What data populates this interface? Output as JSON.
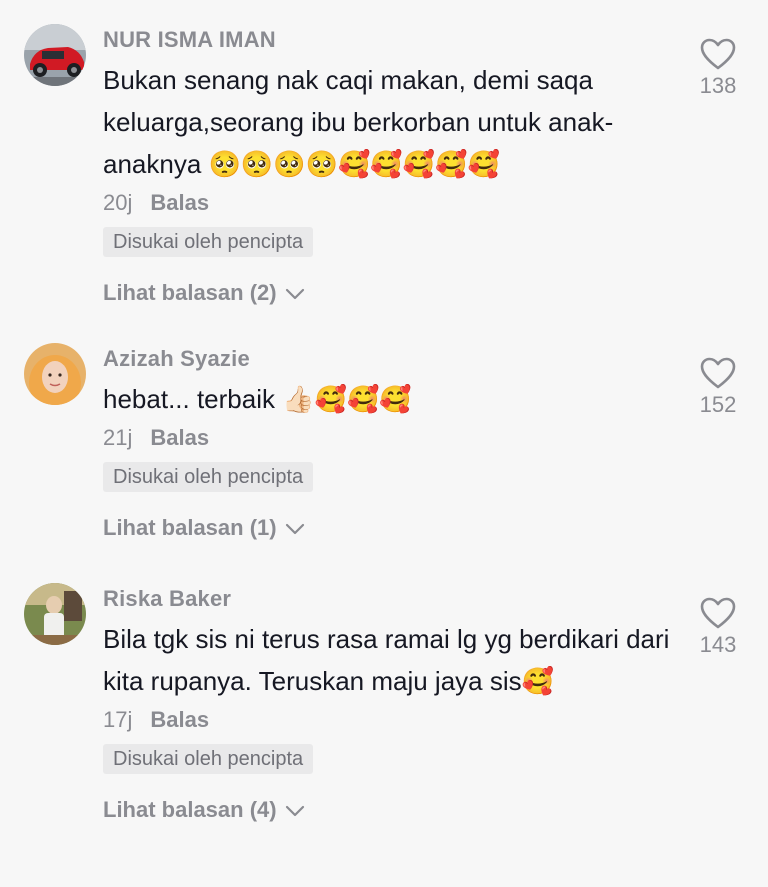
{
  "comments": [
    {
      "username": "NUR ISMA IMAN",
      "text": "Bukan senang nak caqi makan, demi saqa keluarga,seorang ibu berkorban untuk anak-anaknya 🥺🥺🥺🥺🥰🥰🥰🥰🥰",
      "time": "20j",
      "reply_label": "Balas",
      "badge": "Disukai oleh pencipta",
      "view_replies": "Lihat balasan (2)",
      "likes": "138",
      "avatar_icon": "red-car-avatar"
    },
    {
      "username": "Azizah Syazie",
      "text": "hebat... terbaik 👍🏻🥰🥰🥰",
      "time": "21j",
      "reply_label": "Balas",
      "badge": "Disukai oleh pencipta",
      "view_replies": "Lihat balasan (1)",
      "likes": "152",
      "avatar_icon": "woman-hijab-avatar"
    },
    {
      "username": "Riska Baker",
      "text": "Bila tgk sis ni terus rasa ramai lg yg berdikari dari kita rupanya. Teruskan maju jaya sis🥰",
      "time": "17j",
      "reply_label": "Balas",
      "badge": "Disukai oleh pencipta",
      "view_replies": "Lihat balasan (4)",
      "likes": "143",
      "avatar_icon": "person-photo-avatar"
    }
  ],
  "colors": {
    "background": "#f7f7f7",
    "secondary_text": "#8a8b91",
    "primary_text": "#161823",
    "badge_bg": "#e9e9ea"
  }
}
